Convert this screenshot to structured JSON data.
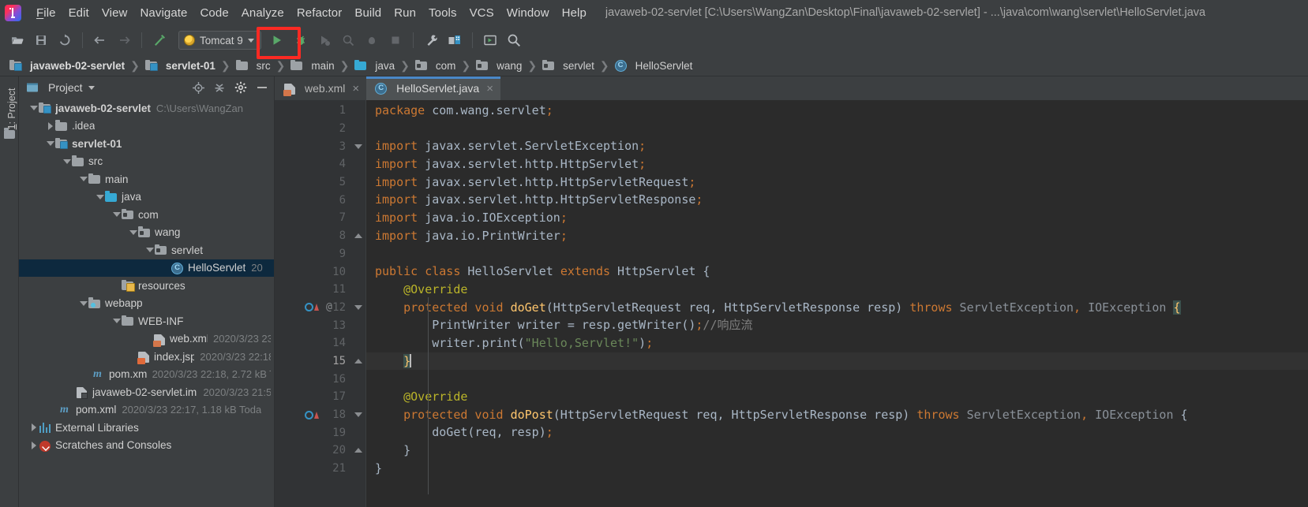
{
  "window": {
    "title": "javaweb-02-servlet [C:\\Users\\WangZan\\Desktop\\Final\\javaweb-02-servlet] - ...\\java\\com\\wang\\servlet\\HelloServlet.java",
    "logo_name": "intellij-idea-logo"
  },
  "menubar": {
    "items": [
      {
        "label": "File"
      },
      {
        "label": "Edit"
      },
      {
        "label": "View"
      },
      {
        "label": "Navigate"
      },
      {
        "label": "Code"
      },
      {
        "label": "Analyze"
      },
      {
        "label": "Refactor"
      },
      {
        "label": "Build"
      },
      {
        "label": "Run"
      },
      {
        "label": "Tools"
      },
      {
        "label": "VCS"
      },
      {
        "label": "Window"
      },
      {
        "label": "Help"
      }
    ]
  },
  "toolbar": {
    "run_config_label": "Tomcat 9",
    "highlight_color": "#fc2a23",
    "run_icon_color": "#59a869",
    "buttons": [
      "open-project-icon",
      "save-all-icon",
      "sync-icon",
      "navigate-back-icon",
      "navigate-forward-icon",
      "build-icon",
      "run-icon",
      "debug-icon",
      "run-with-coverage-icon",
      "profile-icon",
      "stop-icon-inactive",
      "stop-icon",
      "settings-icon",
      "project-structure-icon",
      "update-icon",
      "search-everywhere-icon"
    ]
  },
  "breadcrumbs": [
    {
      "label": "javaweb-02-servlet",
      "icon": "module-icon",
      "bold": true
    },
    {
      "label": "servlet-01",
      "icon": "module-icon",
      "bold": true
    },
    {
      "label": "src",
      "icon": "folder-icon",
      "bold": false
    },
    {
      "label": "main",
      "icon": "folder-icon",
      "bold": false
    },
    {
      "label": "java",
      "icon": "source-folder-icon",
      "bold": false
    },
    {
      "label": "com",
      "icon": "package-icon",
      "bold": false
    },
    {
      "label": "wang",
      "icon": "package-icon",
      "bold": false
    },
    {
      "label": "servlet",
      "icon": "package-icon",
      "bold": false
    },
    {
      "label": "HelloServlet",
      "icon": "class-icon",
      "bold": false
    }
  ],
  "tool_window": {
    "vertical_label": "1: Project",
    "panel_title": "Project",
    "icons": [
      "locate-icon",
      "collapse-all-icon",
      "settings-gear-icon",
      "hide-icon"
    ]
  },
  "project_tree": [
    {
      "depth": 0,
      "arrow": "down",
      "icon": "module-icon",
      "label": "javaweb-02-servlet",
      "bold": true,
      "meta": "C:\\Users\\WangZan",
      "selected": false
    },
    {
      "depth": 1,
      "arrow": "right",
      "icon": "folder-icon",
      "label": ".idea",
      "bold": false,
      "meta": "",
      "selected": false
    },
    {
      "depth": 1,
      "arrow": "down",
      "icon": "module-icon",
      "label": "servlet-01",
      "bold": true,
      "meta": "",
      "selected": false
    },
    {
      "depth": 2,
      "arrow": "down",
      "icon": "folder-icon",
      "label": "src",
      "bold": false,
      "meta": "",
      "selected": false
    },
    {
      "depth": 3,
      "arrow": "down",
      "icon": "folder-icon",
      "label": "main",
      "bold": false,
      "meta": "",
      "selected": false
    },
    {
      "depth": 4,
      "arrow": "down",
      "icon": "source-folder-icon",
      "label": "java",
      "bold": false,
      "meta": "",
      "selected": false
    },
    {
      "depth": 5,
      "arrow": "down",
      "icon": "package-icon",
      "label": "com",
      "bold": false,
      "meta": "",
      "selected": false
    },
    {
      "depth": 6,
      "arrow": "down",
      "icon": "package-icon",
      "label": "wang",
      "bold": false,
      "meta": "",
      "selected": false
    },
    {
      "depth": 7,
      "arrow": "down",
      "icon": "package-icon",
      "label": "servlet",
      "bold": false,
      "meta": "",
      "selected": false
    },
    {
      "depth": 8,
      "arrow": "none",
      "icon": "class-icon",
      "label": "HelloServlet",
      "bold": false,
      "meta": "20",
      "selected": true
    },
    {
      "depth": 4,
      "arrow": "none",
      "icon": "resources-icon",
      "label": "resources",
      "bold": false,
      "meta": "",
      "selected": false
    },
    {
      "depth": 3,
      "arrow": "down",
      "icon": "webapp-icon",
      "label": "webapp",
      "bold": false,
      "meta": "",
      "selected": false
    },
    {
      "depth": 4,
      "arrow": "down",
      "icon": "folder-icon",
      "label": "WEB-INF",
      "bold": false,
      "meta": "",
      "selected": false
    },
    {
      "depth": 5,
      "arrow": "none",
      "icon": "xml-file-icon",
      "label": "web.xml",
      "bold": false,
      "meta": "2020/3/23 23",
      "selected": false
    },
    {
      "depth": 4,
      "arrow": "none",
      "icon": "jsp-file-icon",
      "label": "index.jsp",
      "bold": false,
      "meta": "2020/3/23 22:18",
      "selected": false
    },
    {
      "depth": 3,
      "arrow": "none",
      "icon": "maven-file-icon",
      "label": "pom.xml",
      "bold": false,
      "meta": "2020/3/23 22:18, 2.72 kB To",
      "selected": false
    },
    {
      "depth": 2,
      "arrow": "none",
      "icon": "iml-file-icon",
      "label": "javaweb-02-servlet.iml",
      "bold": false,
      "meta": "2020/3/23 21:5",
      "selected": false
    },
    {
      "depth": 1,
      "arrow": "none",
      "icon": "maven-file-icon",
      "label": "pom.xml",
      "bold": false,
      "meta": "2020/3/23 22:17, 1.18 kB Toda",
      "selected": false
    },
    {
      "depth": 0,
      "arrow": "right",
      "icon": "library-icon",
      "label": "External Libraries",
      "bold": false,
      "meta": "",
      "selected": false
    },
    {
      "depth": 0,
      "arrow": "right",
      "icon": "console-icon",
      "label": "Scratches and Consoles",
      "bold": false,
      "meta": "",
      "selected": false
    }
  ],
  "editor_tabs": [
    {
      "label": "web.xml",
      "icon": "xml-file-icon",
      "active": false,
      "close": "×"
    },
    {
      "label": "HelloServlet.java",
      "icon": "class-icon",
      "active": true,
      "close": "×"
    }
  ],
  "code": {
    "line_numbers": [
      "1",
      "2",
      "3",
      "4",
      "5",
      "6",
      "7",
      "8",
      "9",
      "10",
      "11",
      "12",
      "13",
      "14",
      "15",
      "16",
      "17",
      "18",
      "19",
      "20",
      "21"
    ],
    "current_line": 15,
    "lines": [
      "package com.wang.servlet;",
      "",
      "import javax.servlet.ServletException;",
      "import javax.servlet.http.HttpServlet;",
      "import javax.servlet.http.HttpServletRequest;",
      "import javax.servlet.http.HttpServletResponse;",
      "import java.io.IOException;",
      "import java.io.PrintWriter;",
      "",
      "public class HelloServlet extends HttpServlet {",
      "    @Override",
      "    protected void doGet(HttpServletRequest req, HttpServletResponse resp) throws ServletException, IOException {",
      "        PrintWriter writer = resp.getWriter();//响应流",
      "        writer.print(\"Hello,Servlet!\");",
      "    }",
      "",
      "    @Override",
      "    protected void doPost(HttpServletRequest req, HttpServletResponse resp) throws ServletException, IOException {",
      "        doGet(req, resp);",
      "    }",
      "}"
    ],
    "colors": {
      "keyword": "#cc7832",
      "annotation": "#bbb529",
      "string": "#6a8759",
      "comment": "#808080",
      "method": "#ffc66d",
      "text": "#a9b7c6",
      "background": "#2b2b2b",
      "gutter_background": "#313335"
    },
    "gutter_marks": {
      "12": [
        "override-method-icon",
        "implementation-arrow-icon",
        "annotation-at-sign"
      ],
      "18": [
        "override-method-icon",
        "implementation-arrow-icon"
      ]
    }
  }
}
